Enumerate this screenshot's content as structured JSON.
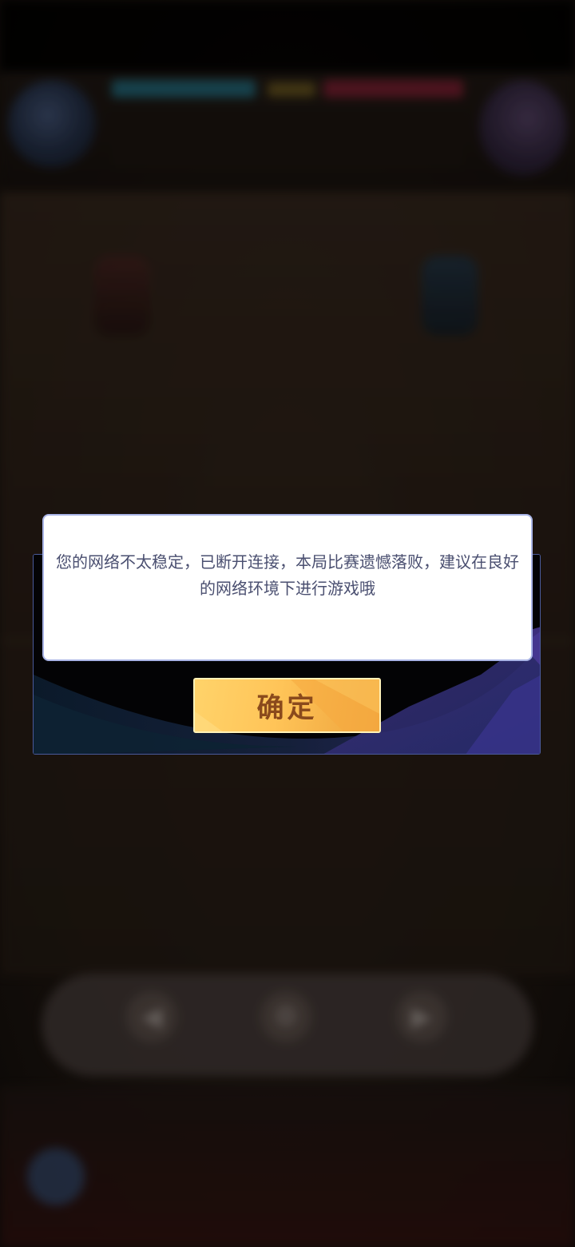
{
  "dialog": {
    "message": "您的网络不太稳定，已断开连接，本局比赛遗憾落败，建议在良好的网络环境下进行游戏哦",
    "confirm_label": "确定"
  },
  "background": {
    "controls": [
      {
        "icon": "rewind-icon",
        "glyph": "◀"
      },
      {
        "icon": "settings-icon",
        "glyph": "⚙"
      },
      {
        "icon": "play-icon",
        "glyph": "▶"
      }
    ]
  },
  "colors": {
    "dialog_border": "#4a5a9a",
    "message_text": "#4a4f70",
    "button_gold": "#ffc458",
    "button_text": "#8a4a1c"
  }
}
